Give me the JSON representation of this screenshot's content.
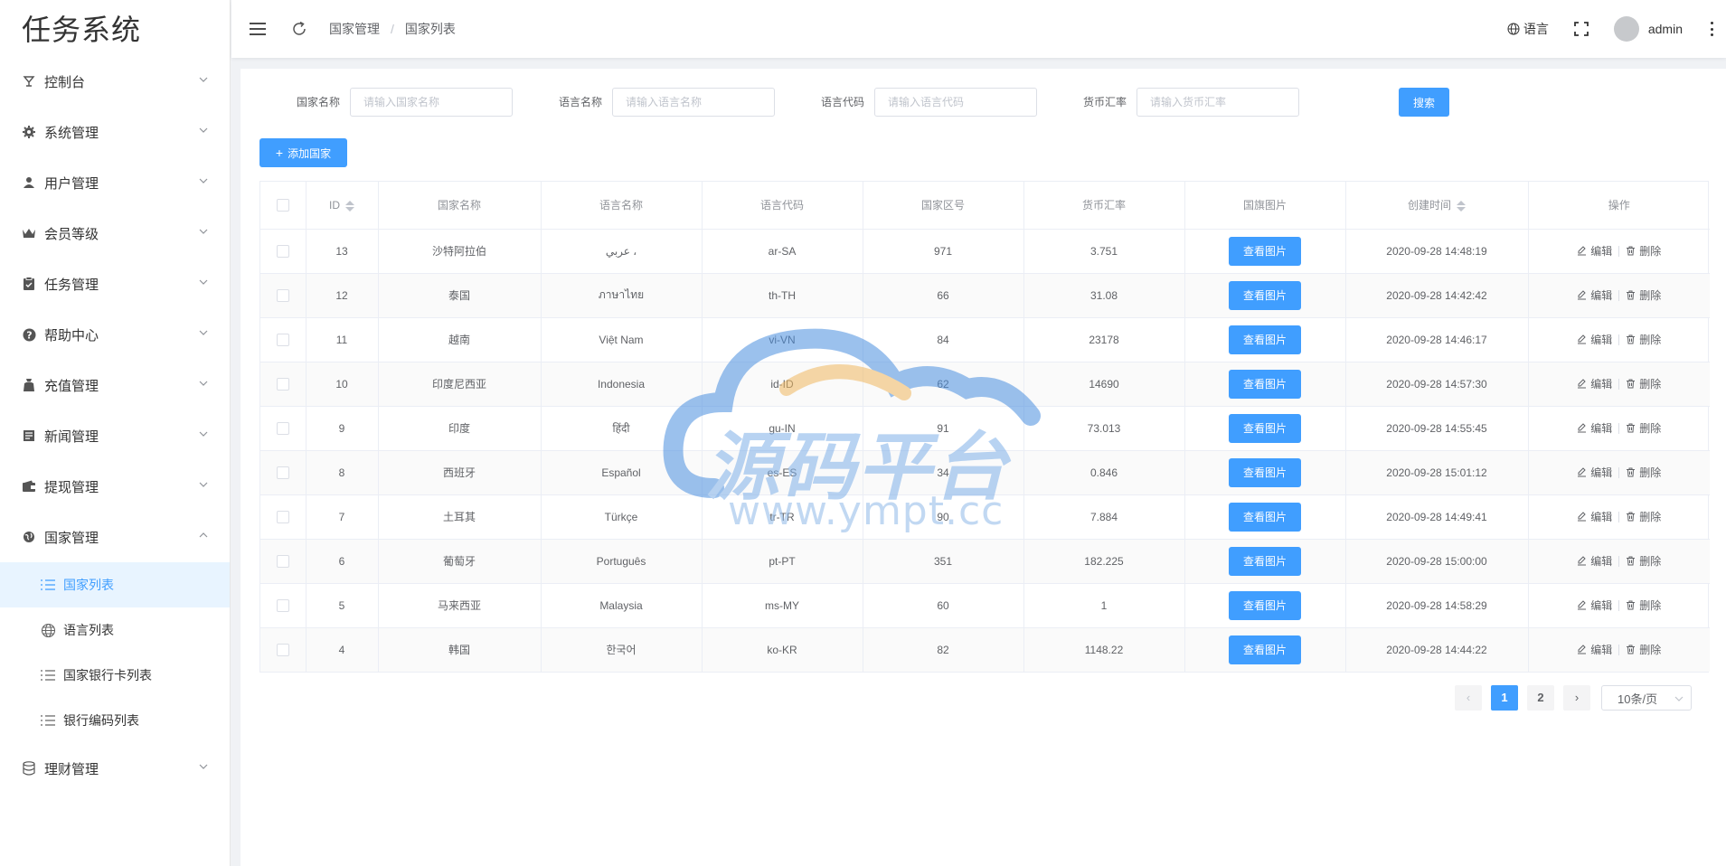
{
  "app": {
    "title": "任务系统"
  },
  "sidebar": {
    "items": [
      {
        "label": "控制台",
        "icon": "dashboard-icon"
      },
      {
        "label": "系统管理",
        "icon": "gear-icon"
      },
      {
        "label": "用户管理",
        "icon": "user-icon"
      },
      {
        "label": "会员等级",
        "icon": "crown-icon"
      },
      {
        "label": "任务管理",
        "icon": "clipboard-icon"
      },
      {
        "label": "帮助中心",
        "icon": "question-icon"
      },
      {
        "label": "充值管理",
        "icon": "wallet-icon"
      },
      {
        "label": "新闻管理",
        "icon": "news-icon"
      },
      {
        "label": "提现管理",
        "icon": "withdraw-icon"
      },
      {
        "label": "国家管理",
        "icon": "globe-icon",
        "expanded": true
      },
      {
        "label": "理财管理",
        "icon": "database-icon"
      }
    ],
    "sub_items": [
      {
        "label": "国家列表",
        "icon": "list-icon",
        "active": true
      },
      {
        "label": "语言列表",
        "icon": "globe-icon"
      },
      {
        "label": "国家银行卡列表",
        "icon": "list-icon"
      },
      {
        "label": "银行编码列表",
        "icon": "list-icon"
      }
    ]
  },
  "header": {
    "breadcrumb": [
      "国家管理",
      "国家列表"
    ],
    "language_label": "语言",
    "username": "admin"
  },
  "filters": [
    {
      "label": "国家名称",
      "placeholder": "请输入国家名称"
    },
    {
      "label": "语言名称",
      "placeholder": "请输入语言名称"
    },
    {
      "label": "语言代码",
      "placeholder": "请输入语言代码"
    },
    {
      "label": "货币汇率",
      "placeholder": "请输入货币汇率"
    }
  ],
  "actions": {
    "search_label": "搜索",
    "add_label": "添加国家"
  },
  "table": {
    "columns": [
      "ID",
      "国家名称",
      "语言名称",
      "语言代码",
      "国家区号",
      "货币汇率",
      "国旗图片",
      "创建时间",
      "操作"
    ],
    "view_label": "查看图片",
    "edit_label": "编辑",
    "delete_label": "删除",
    "rows": [
      {
        "id": "13",
        "country": "沙特阿拉伯",
        "language": "عربي ،",
        "code": "ar-SA",
        "area": "971",
        "rate": "3.751",
        "created": "2020-09-28 14:48:19"
      },
      {
        "id": "12",
        "country": "泰国",
        "language": "ภาษาไทย",
        "code": "th-TH",
        "area": "66",
        "rate": "31.08",
        "created": "2020-09-28 14:42:42"
      },
      {
        "id": "11",
        "country": "越南",
        "language": "Việt Nam",
        "code": "vi-VN",
        "area": "84",
        "rate": "23178",
        "created": "2020-09-28 14:46:17"
      },
      {
        "id": "10",
        "country": "印度尼西亚",
        "language": "Indonesia",
        "code": "id-ID",
        "area": "62",
        "rate": "14690",
        "created": "2020-09-28 14:57:30"
      },
      {
        "id": "9",
        "country": "印度",
        "language": "हिंदी",
        "code": "gu-IN",
        "area": "91",
        "rate": "73.013",
        "created": "2020-09-28 14:55:45"
      },
      {
        "id": "8",
        "country": "西班牙",
        "language": "Español",
        "code": "es-ES",
        "area": "34",
        "rate": "0.846",
        "created": "2020-09-28 15:01:12"
      },
      {
        "id": "7",
        "country": "土耳其",
        "language": "Türkçe",
        "code": "tr-TR",
        "area": "90",
        "rate": "7.884",
        "created": "2020-09-28 14:49:41"
      },
      {
        "id": "6",
        "country": "葡萄牙",
        "language": "Português",
        "code": "pt-PT",
        "area": "351",
        "rate": "182.225",
        "created": "2020-09-28 15:00:00"
      },
      {
        "id": "5",
        "country": "马来西亚",
        "language": "Malaysia",
        "code": "ms-MY",
        "area": "60",
        "rate": "1",
        "created": "2020-09-28 14:58:29"
      },
      {
        "id": "4",
        "country": "韩国",
        "language": "한국어",
        "code": "ko-KR",
        "area": "82",
        "rate": "1148.22",
        "created": "2020-09-28 14:44:22"
      }
    ]
  },
  "pagination": {
    "pages": [
      "1",
      "2"
    ],
    "current": "1",
    "page_size_label": "10条/页"
  },
  "watermark": {
    "text": "源码平台",
    "url": "www.ympt.cc"
  },
  "colors": {
    "primary": "#409eff",
    "active_bg": "#e8f4ff"
  }
}
